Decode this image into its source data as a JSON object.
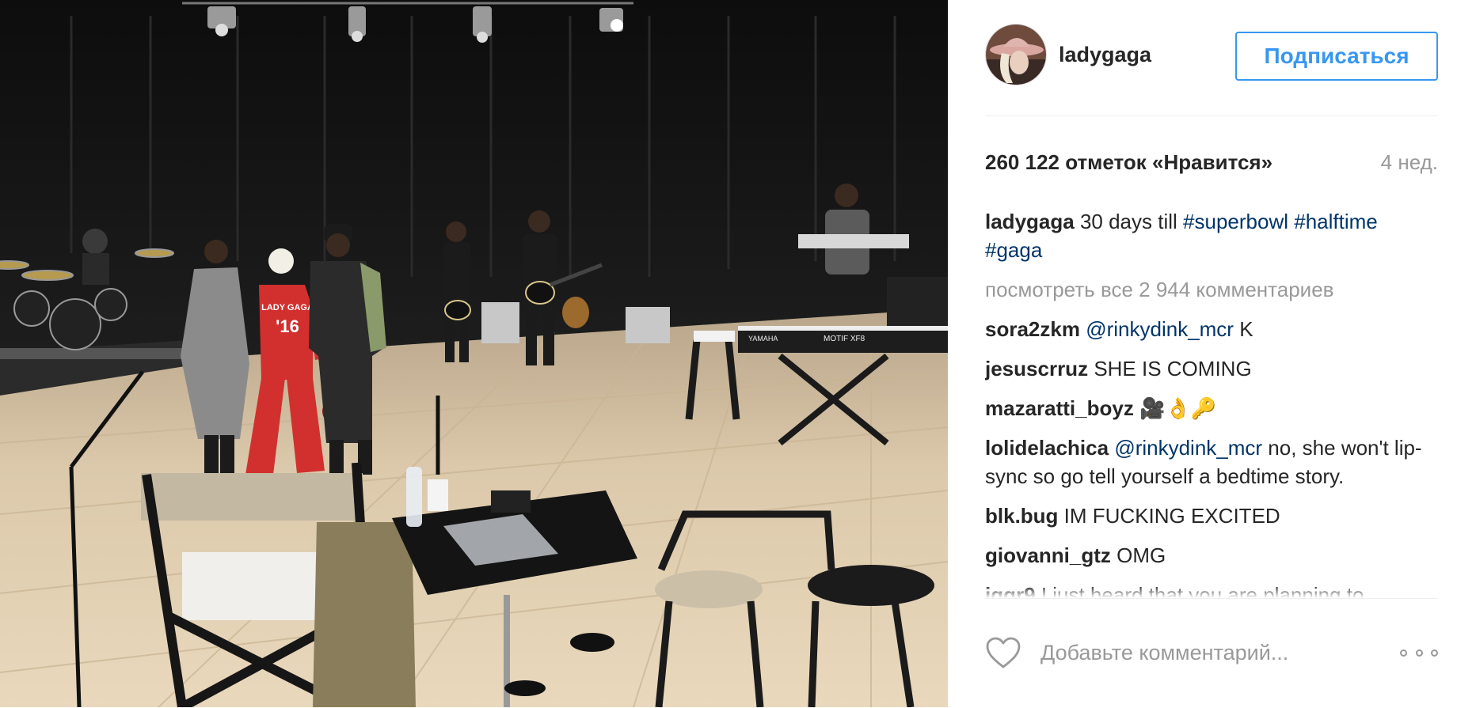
{
  "post": {
    "username": "ladygaga",
    "follow_label": "Подписаться",
    "likes_text": "260 122 отметок «Нравится»",
    "time_ago": "4 нед.",
    "caption": {
      "user": "ladygaga",
      "text": "30 days till ",
      "tags": [
        "#superbowl",
        "#halftime",
        "#gaga"
      ]
    },
    "view_all_comments": "посмотреть все 2 944 комментариев",
    "comments": [
      {
        "user": "sora2zkm",
        "mention": "@rinkydink_mcr",
        "text": " K"
      },
      {
        "user": "jesuscrruz",
        "mention": "",
        "text": "SHE IS COMING"
      },
      {
        "user": "mazaratti_boyz",
        "mention": "",
        "text": "🎥👌🔑"
      },
      {
        "user": "lolidelachica",
        "mention": "@rinkydink_mcr",
        "text": " no, she won't lip-sync so go tell yourself a bedtime story."
      },
      {
        "user": "blk.bug",
        "mention": "",
        "text": "IM FUCKING EXCITED"
      },
      {
        "user": "giovanni_gtz",
        "mention": "",
        "text": "OMG"
      },
      {
        "user": "jggr9",
        "mention": "",
        "text": "I just heard that you are planning to"
      }
    ],
    "comment_placeholder": "Добавьте комментарий...",
    "photo_labels": {
      "jacket_top": "LADY GAGA",
      "jacket_number": "'16",
      "keyboard_label": "MOTIF XF8",
      "keyboard_brand": "YAMAHA"
    }
  },
  "icons": {
    "heart": "heart-icon",
    "more": "more-options-icon"
  },
  "colors": {
    "accent": "#3897f0",
    "tag": "#003569",
    "muted": "#999999",
    "text": "#262626"
  }
}
